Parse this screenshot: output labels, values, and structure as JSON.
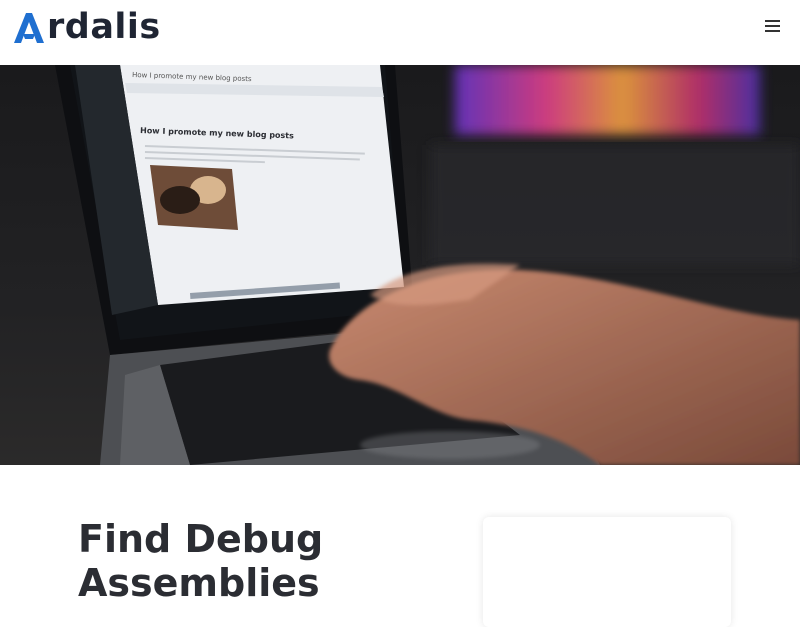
{
  "header": {
    "logo_text": "rdalis",
    "logo_letter": "A",
    "brand_color": "#1f6fd0",
    "menu_icon": "hamburger-menu-icon"
  },
  "hero": {
    "image": "laptop-typing-blog-editor",
    "screen": {
      "post_title": "How I promote my new blog posts",
      "tab_title": "How I promote my new blog posts"
    }
  },
  "main": {
    "title": "Find Debug Assemblies"
  }
}
